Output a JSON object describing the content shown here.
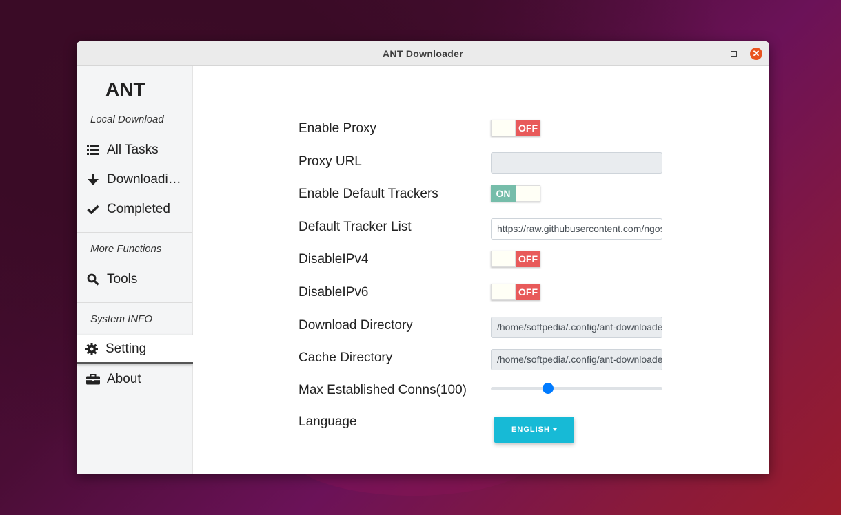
{
  "window": {
    "title": "ANT Downloader"
  },
  "sidebar": {
    "brand": "ANT",
    "sections": [
      {
        "label": "Local Download",
        "items": [
          {
            "icon": "list-icon",
            "label": "All Tasks"
          },
          {
            "icon": "download-arrow-icon",
            "label": "Downloadi…"
          },
          {
            "icon": "check-icon",
            "label": "Completed"
          }
        ]
      },
      {
        "label": "More Functions",
        "items": [
          {
            "icon": "search-icon",
            "label": "Tools"
          }
        ]
      },
      {
        "label": "System INFO",
        "items": [
          {
            "icon": "gear-icon",
            "label": "Setting",
            "active": true
          },
          {
            "icon": "briefcase-icon",
            "label": "About"
          }
        ]
      }
    ]
  },
  "settings": {
    "enable_proxy": {
      "label": "Enable Proxy",
      "state": "OFF"
    },
    "proxy_url": {
      "label": "Proxy URL",
      "value": ""
    },
    "enable_default_trackers": {
      "label": "Enable Default Trackers",
      "state": "ON"
    },
    "default_tracker_list": {
      "label": "Default Tracker List",
      "value": "https://raw.githubusercontent.com/ngosang/trackerslist/master/trackers_best.txt"
    },
    "disable_ipv4": {
      "label": "DisableIPv4",
      "state": "OFF"
    },
    "disable_ipv6": {
      "label": "DisableIPv6",
      "state": "OFF"
    },
    "download_directory": {
      "label": "Download Directory",
      "value": "/home/softpedia/.config/ant-downloader"
    },
    "cache_directory": {
      "label": "Cache Directory",
      "value": "/home/softpedia/.config/ant-downloader"
    },
    "max_established_conns": {
      "label": "Max Established Conns(100)",
      "value": 100,
      "min": 0,
      "max": 300
    },
    "language": {
      "label": "Language",
      "selected": "ENGLISH"
    }
  },
  "colors": {
    "toggle_off": "#e85a5a",
    "toggle_on": "#76bdaa",
    "accent": "#17bad6",
    "slider": "#007bff",
    "close": "#e95420"
  }
}
